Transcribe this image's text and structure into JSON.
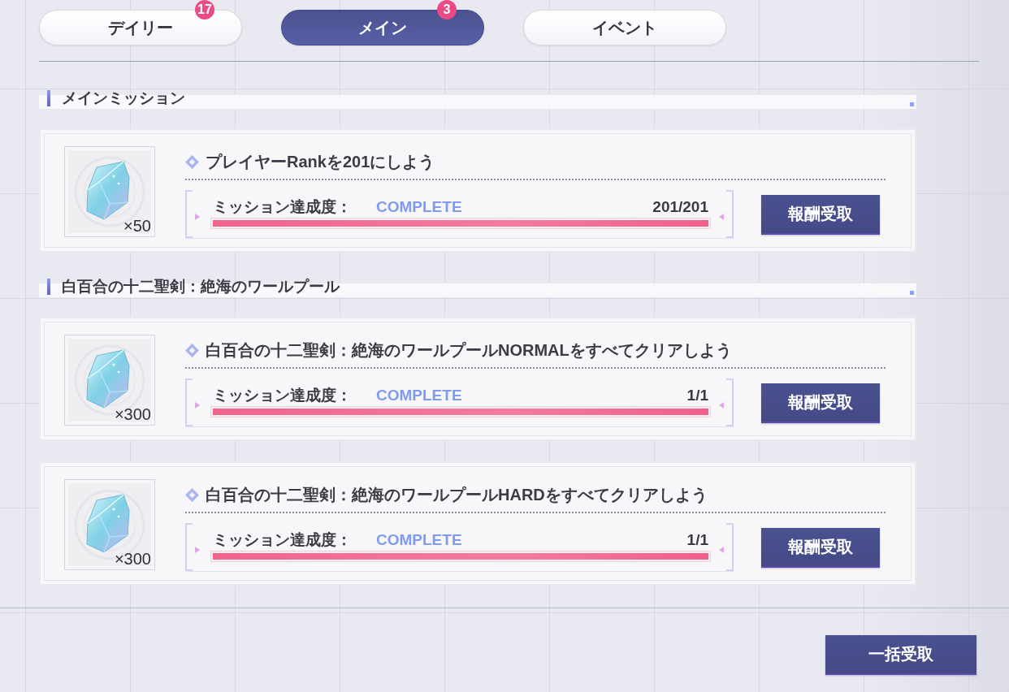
{
  "tabs": [
    {
      "label": "デイリー",
      "selected": false,
      "badge": "17"
    },
    {
      "label": "メイン",
      "selected": true,
      "badge": "3"
    },
    {
      "label": "イベント",
      "selected": false
    }
  ],
  "sections": [
    {
      "title": "メインミッション",
      "missions": [
        {
          "quantity": "×50",
          "title": "プレイヤーRankを201にしよう",
          "progress_label": "ミッション達成度：",
          "status": "COMPLETE",
          "level": 1,
          "reading": "201/201",
          "button": "報酬受取"
        }
      ]
    },
    {
      "title": "白百合の十二聖剣：絶海のワールプール",
      "missions": [
        {
          "quantity": "×300",
          "title": "白百合の十二聖剣：絶海のワールプールNORMALをすべてクリアしよう",
          "progress_label": "ミッション達成度：",
          "status": "COMPLETE",
          "level": 1,
          "reading": "1/1",
          "button": "報酬受取"
        },
        {
          "quantity": "×300",
          "title": "白百合の十二聖剣：絶海のワールプールHARDをすべてクリアしよう",
          "progress_label": "ミッション達成度：",
          "status": "COMPLETE",
          "level": 1,
          "reading": "1/1",
          "button": "報酬受取"
        }
      ]
    }
  ],
  "claim_all_button": "一括受取"
}
